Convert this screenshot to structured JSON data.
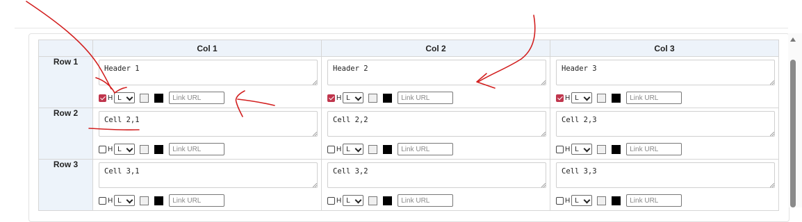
{
  "table": {
    "columns": [
      "Col 1",
      "Col 2",
      "Col 3"
    ],
    "rows": [
      {
        "label": "Row 1",
        "cells": [
          {
            "text": "Header 1",
            "header_checked": true,
            "h_label": "H",
            "align": "L",
            "link_placeholder": "Link URL"
          },
          {
            "text": "Header 2",
            "header_checked": true,
            "h_label": "H",
            "align": "L",
            "link_placeholder": "Link URL"
          },
          {
            "text": "Header 3",
            "header_checked": true,
            "h_label": "H",
            "align": "L",
            "link_placeholder": "Link URL"
          }
        ]
      },
      {
        "label": "Row 2",
        "cells": [
          {
            "text": "Cell 2,1",
            "header_checked": false,
            "h_label": "H",
            "align": "L",
            "link_placeholder": "Link URL"
          },
          {
            "text": "Cell 2,2",
            "header_checked": false,
            "h_label": "H",
            "align": "L",
            "link_placeholder": "Link URL"
          },
          {
            "text": "Cell 2,3",
            "header_checked": false,
            "h_label": "H",
            "align": "L",
            "link_placeholder": "Link URL"
          }
        ]
      },
      {
        "label": "Row 3",
        "cells": [
          {
            "text": "Cell 3,1",
            "header_checked": false,
            "h_label": "H",
            "align": "L",
            "link_placeholder": "Link URL"
          },
          {
            "text": "Cell 3,2",
            "header_checked": false,
            "h_label": "H",
            "align": "L",
            "link_placeholder": "Link URL"
          },
          {
            "text": "Cell 3,3",
            "header_checked": false,
            "h_label": "H",
            "align": "L",
            "link_placeholder": "Link URL"
          }
        ]
      }
    ]
  },
  "colors": {
    "header_bg": "#edf3fa",
    "checkbox_checked": "#c0364d",
    "annotation_red": "#d21f1f",
    "text_color_swatch": "#000000",
    "bg_color_swatch": "#f0f0f0"
  },
  "icons": [
    "resize-grip-icon",
    "chevron-down-icon",
    "scroll-up-arrow-icon"
  ]
}
